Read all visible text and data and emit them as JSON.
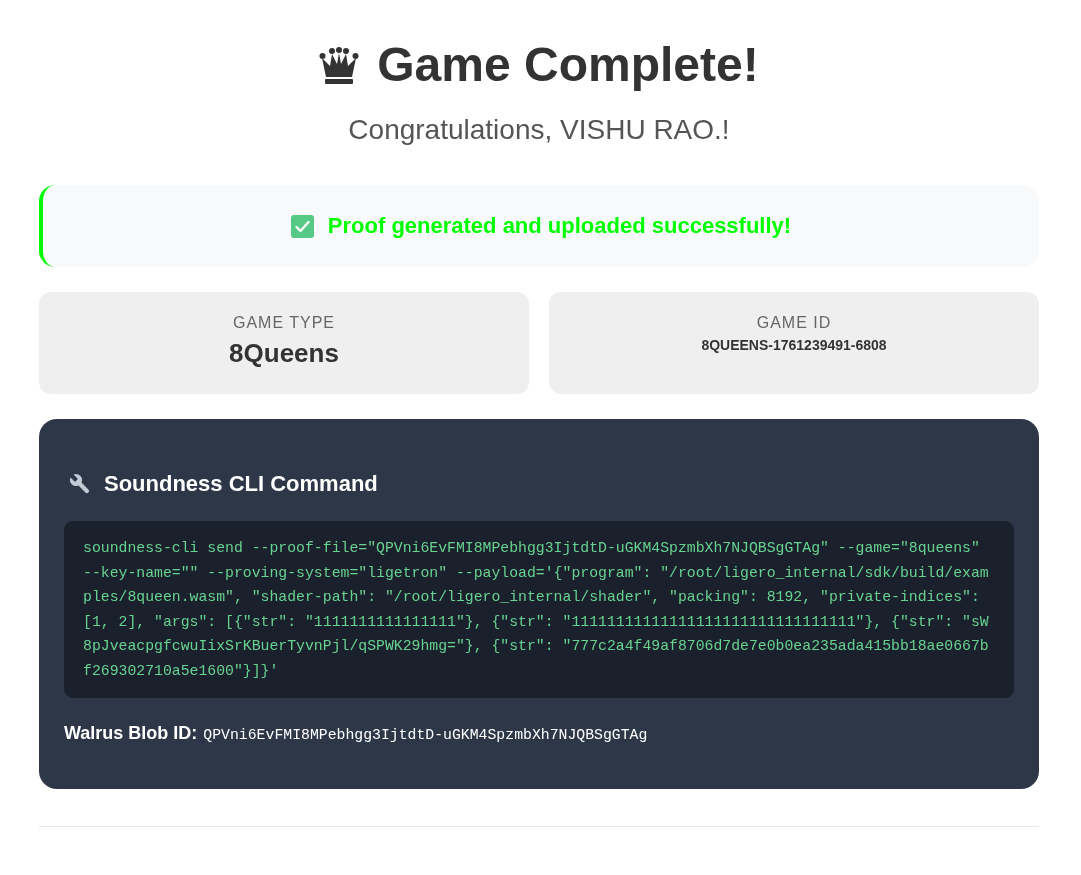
{
  "header": {
    "title": "Game Complete!",
    "subtitle": "Congratulations, VISHU RAO.!"
  },
  "status_banner": {
    "kind": "success",
    "message": "Proof generated and uploaded successfully!"
  },
  "info_cards": [
    {
      "kind": "large",
      "label": "GAME TYPE",
      "value": "8Queens"
    },
    {
      "kind": "small",
      "label": "GAME ID",
      "value": "8QUEENS-1761239491-6808"
    }
  ],
  "cli_panel": {
    "title": "Soundness CLI Command",
    "command": "soundness-cli send --proof-file=\"QPVni6EvFMI8MPebhgg3IjtdtD-uGKM4SpzmbXh7NJQBSgGTAg\" --game=\"8queens\" --key-name=\"\" --proving-system=\"ligetron\" --payload='{\"program\": \"/root/ligero_internal/sdk/build/examples/8queen.wasm\", \"shader-path\": \"/root/ligero_internal/shader\", \"packing\": 8192, \"private-indices\": [1, 2], \"args\": [{\"str\": \"1111111111111111\"}, {\"str\": \"11111111111111111111111111111111\"}, {\"str\": \"sW8pJveacpgfcwuIixSrKBuerTyvnPjl/qSPWK29hmg=\"}, {\"str\": \"777c2a4f49af8706d7de7e0b0ea235ada415bb18ae0667bf269302710a5e1600\"}]}'",
    "blob_label": "Walrus Blob ID:",
    "blob_id": "QPVni6EvFMI8MPebhgg3IjtdtD-uGKM4SpzmbXh7NJQBSgGTAg"
  }
}
